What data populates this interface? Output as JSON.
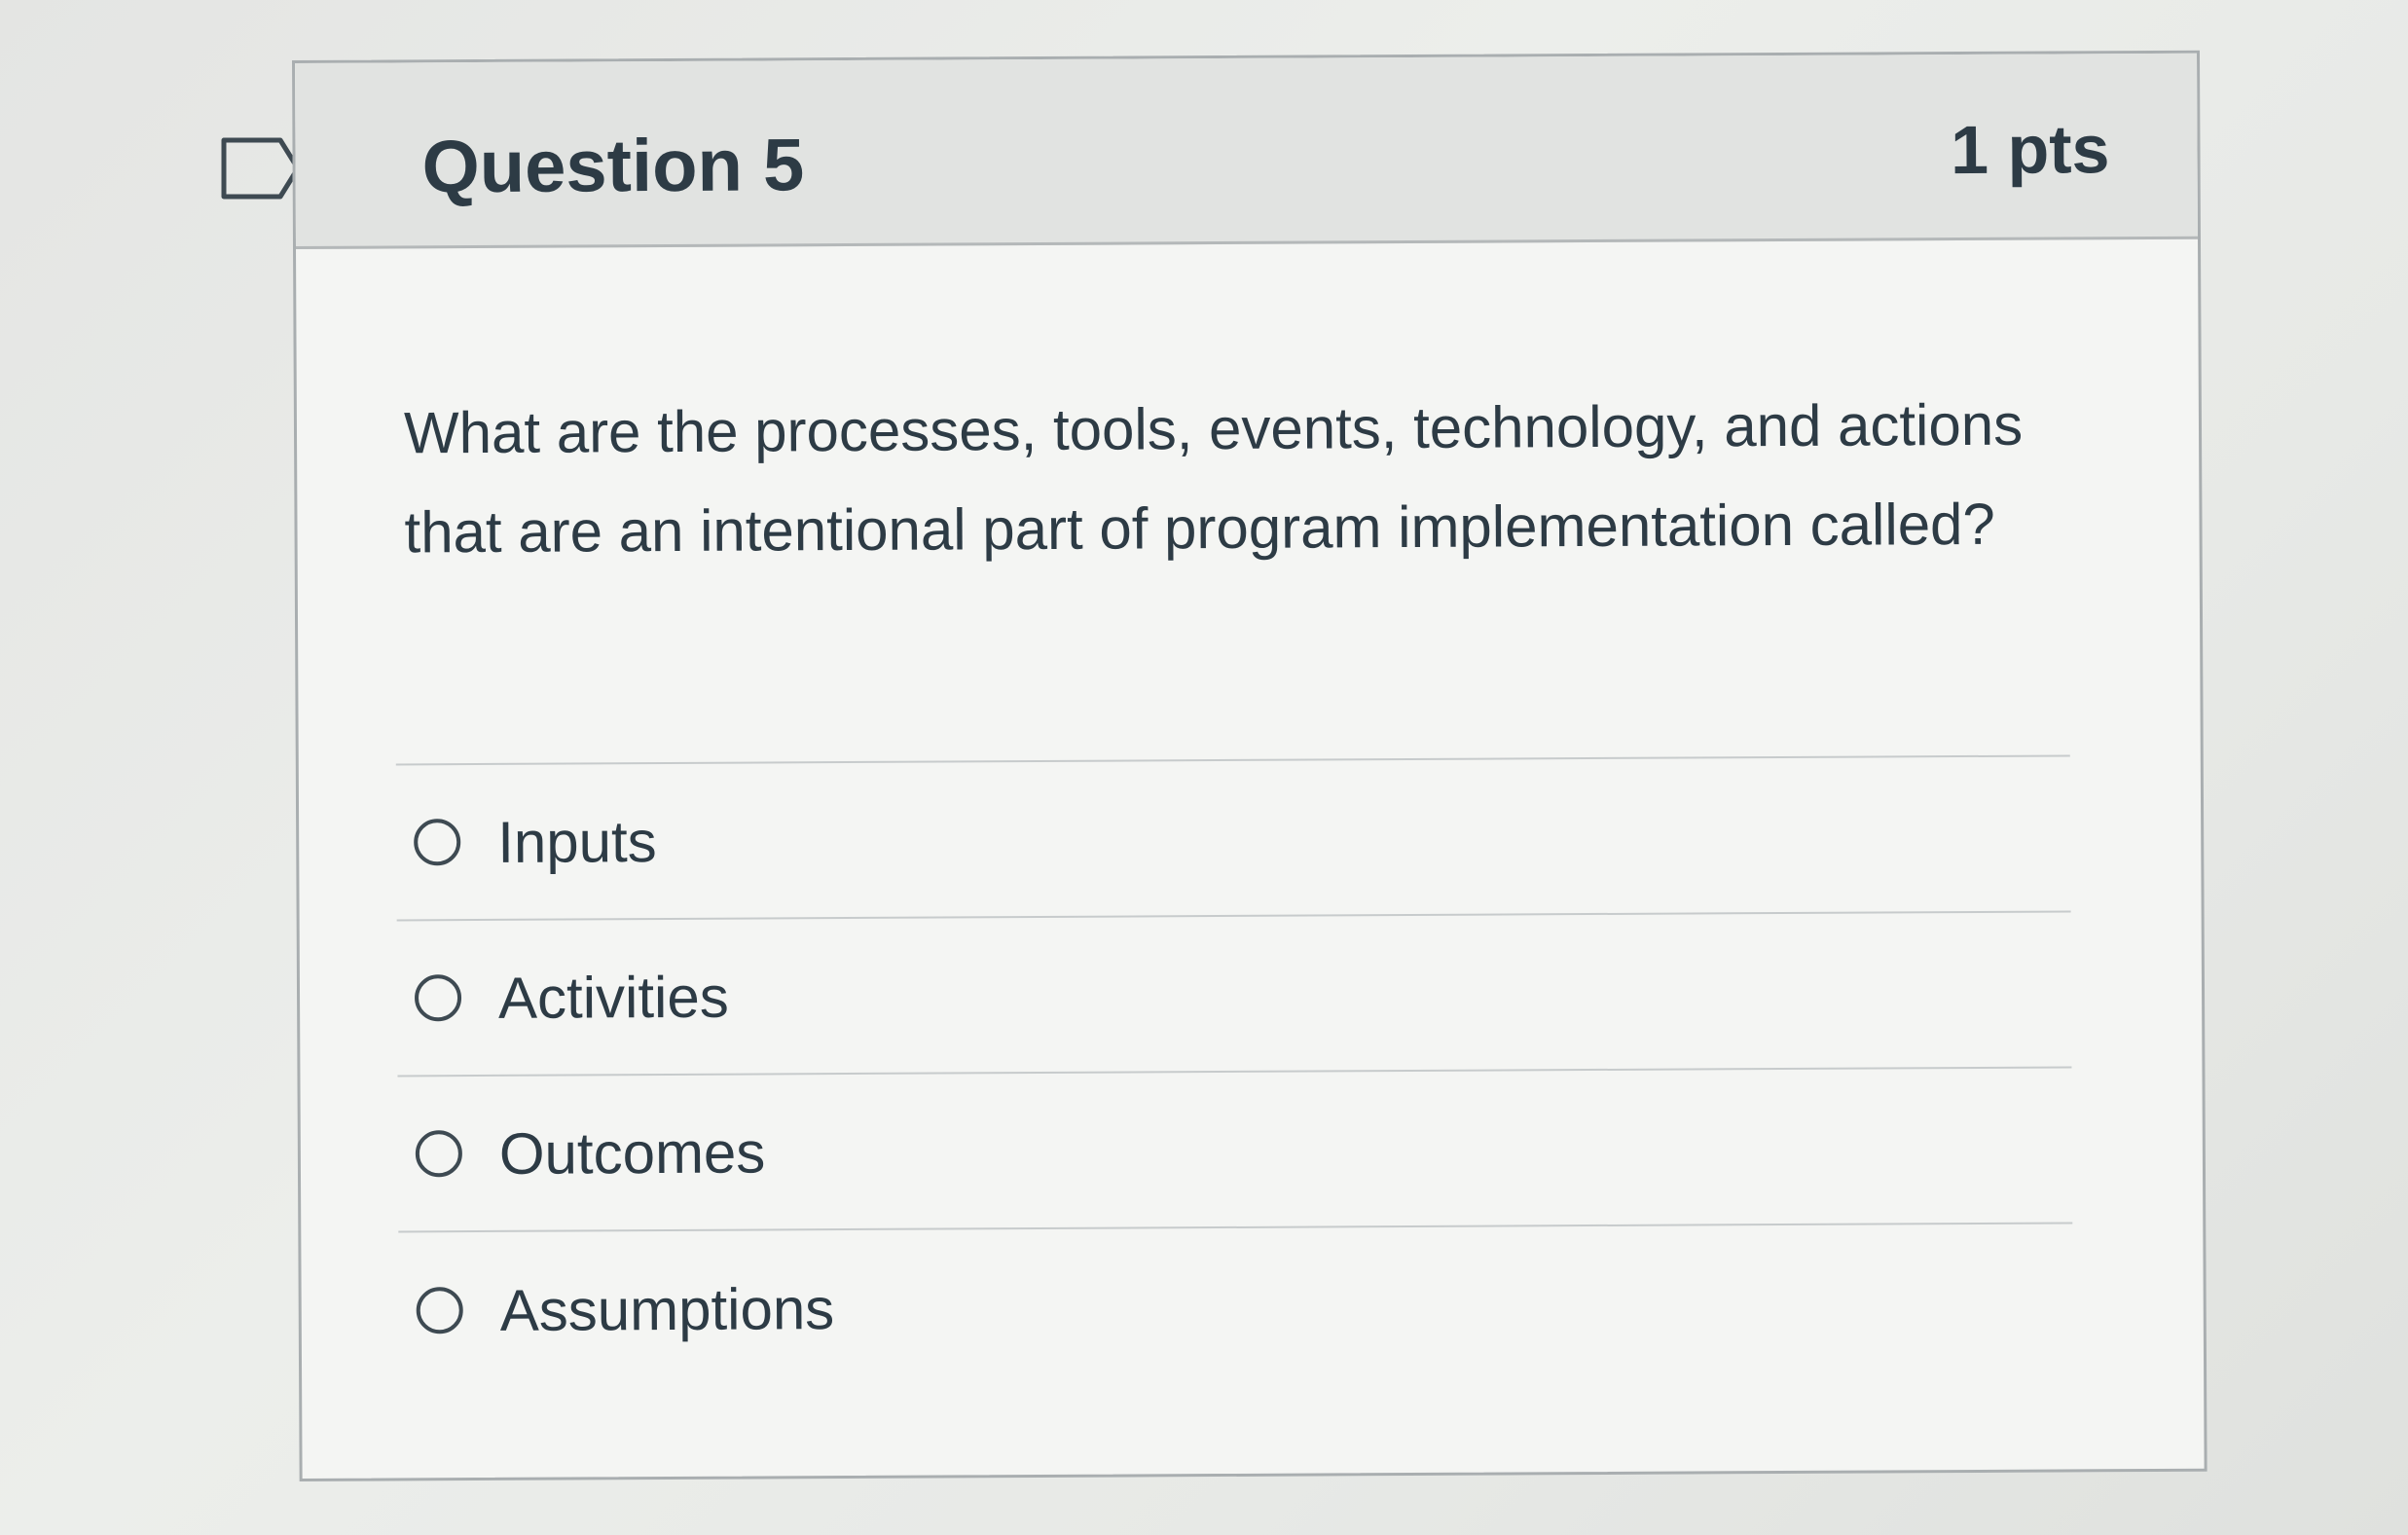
{
  "question": {
    "title": "Question 5",
    "points": "1 pts",
    "text": "What are the processes, tools, events, technology, and actions that are an intentional part of program implementation called?"
  },
  "answers": [
    {
      "label": "Inputs",
      "selected": false
    },
    {
      "label": "Activities",
      "selected": false
    },
    {
      "label": "Outcomes",
      "selected": false
    },
    {
      "label": "Assumptions",
      "selected": false
    }
  ],
  "icons": {
    "flag": "flag-icon",
    "radio": "radio-unchecked-icon"
  },
  "colors": {
    "text": "#2d3b45",
    "header_background": "#e1e3e1",
    "border": "#a9aeb0"
  }
}
